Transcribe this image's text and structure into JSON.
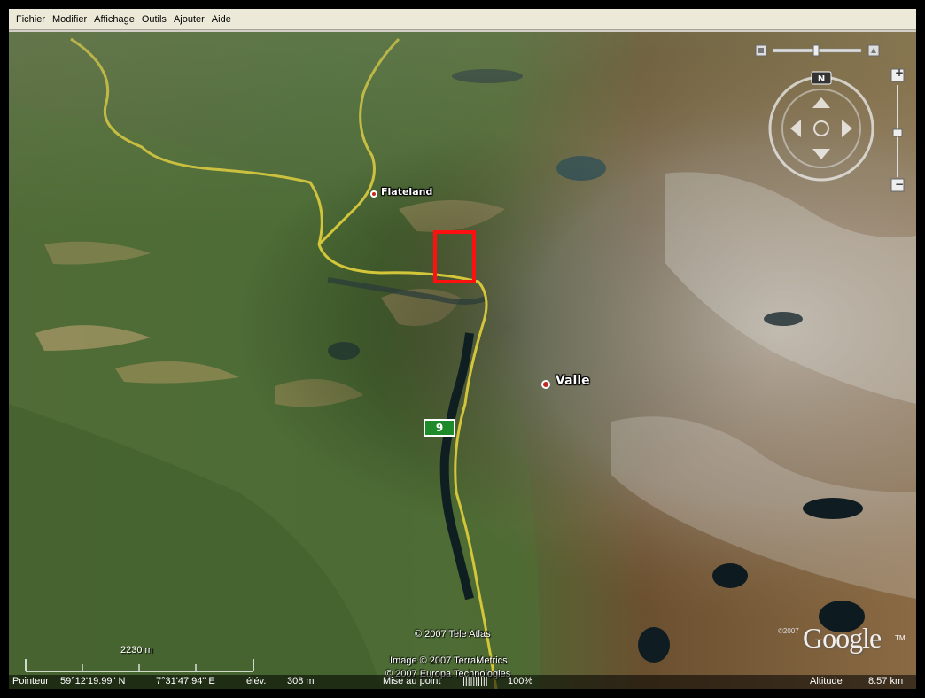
{
  "menu": {
    "items": [
      "Fichier",
      "Modifier",
      "Affichage",
      "Outils",
      "Ajouter",
      "Aide"
    ]
  },
  "map": {
    "places": {
      "flateland": "Flateland",
      "valle": "Valle"
    },
    "route_number": "9",
    "compass_north": "N",
    "zoom_in": "+",
    "zoom_out": "−",
    "credits": {
      "tele_atlas": "© 2007 Tele Atlas",
      "terrametrics": "Image © 2007 TerraMetrics",
      "europa": "© 2007 Europa Technologies"
    },
    "logo_year": "©2007",
    "logo": "Google",
    "logo_tm": "TM"
  },
  "scale": {
    "label": "2230 m"
  },
  "status": {
    "pointer_label": "Pointeur",
    "lat": "59°12'19.99\" N",
    "lon": "7°31'47.94\" E",
    "elev_label": "élév.",
    "elev_value": "308 m",
    "streaming_label": "Mise au point",
    "streaming_bars": "||||||||||",
    "streaming_pct": "100%",
    "altitude_label": "Altitude",
    "altitude_value": "8.57 km"
  },
  "colors": {
    "marker": "#ff1010",
    "road": "#d4c63a",
    "route_shield": "#1e8a2a",
    "place_dot": "#c62828"
  }
}
